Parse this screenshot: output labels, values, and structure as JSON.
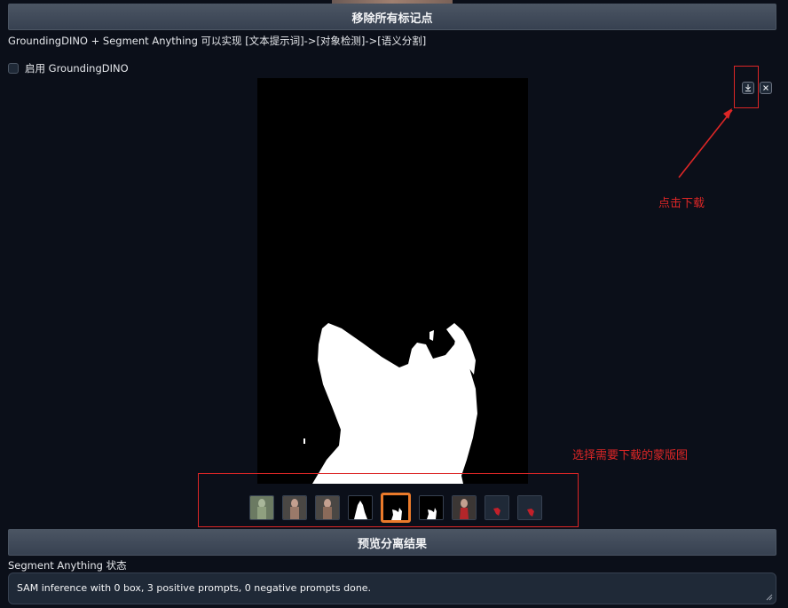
{
  "buttons": {
    "remove_markers": "移除所有标记点",
    "preview_segmentation": "预览分离结果"
  },
  "description": "GroundingDINO + Segment Anything 可以实现 [文本提示词]->[对象检测]->[语义分割]",
  "checkbox": {
    "label": "启用 GroundingDINO",
    "checked": false
  },
  "gallery": {
    "download_icon": "download-icon",
    "close_icon": "close-icon",
    "selected_index": 4,
    "thumbnails": [
      {
        "kind": "photo-green-tint"
      },
      {
        "kind": "photo"
      },
      {
        "kind": "photo"
      },
      {
        "kind": "mask-white-figure"
      },
      {
        "kind": "mask-white-small"
      },
      {
        "kind": "mask-white-small"
      },
      {
        "kind": "photo-red-dress"
      },
      {
        "kind": "cutout-red"
      },
      {
        "kind": "cutout-red"
      }
    ]
  },
  "annotations": {
    "click_download": "点击下载",
    "select_mask": "选择需要下载的蒙版图"
  },
  "status": {
    "label": "Segment Anything 状态",
    "text": "SAM inference with 0 box, 3 positive prompts, 0 negative prompts done."
  },
  "colors": {
    "background": "#0b0f19",
    "annotation": "#dc2626",
    "selected_border": "#ea7a2a"
  }
}
